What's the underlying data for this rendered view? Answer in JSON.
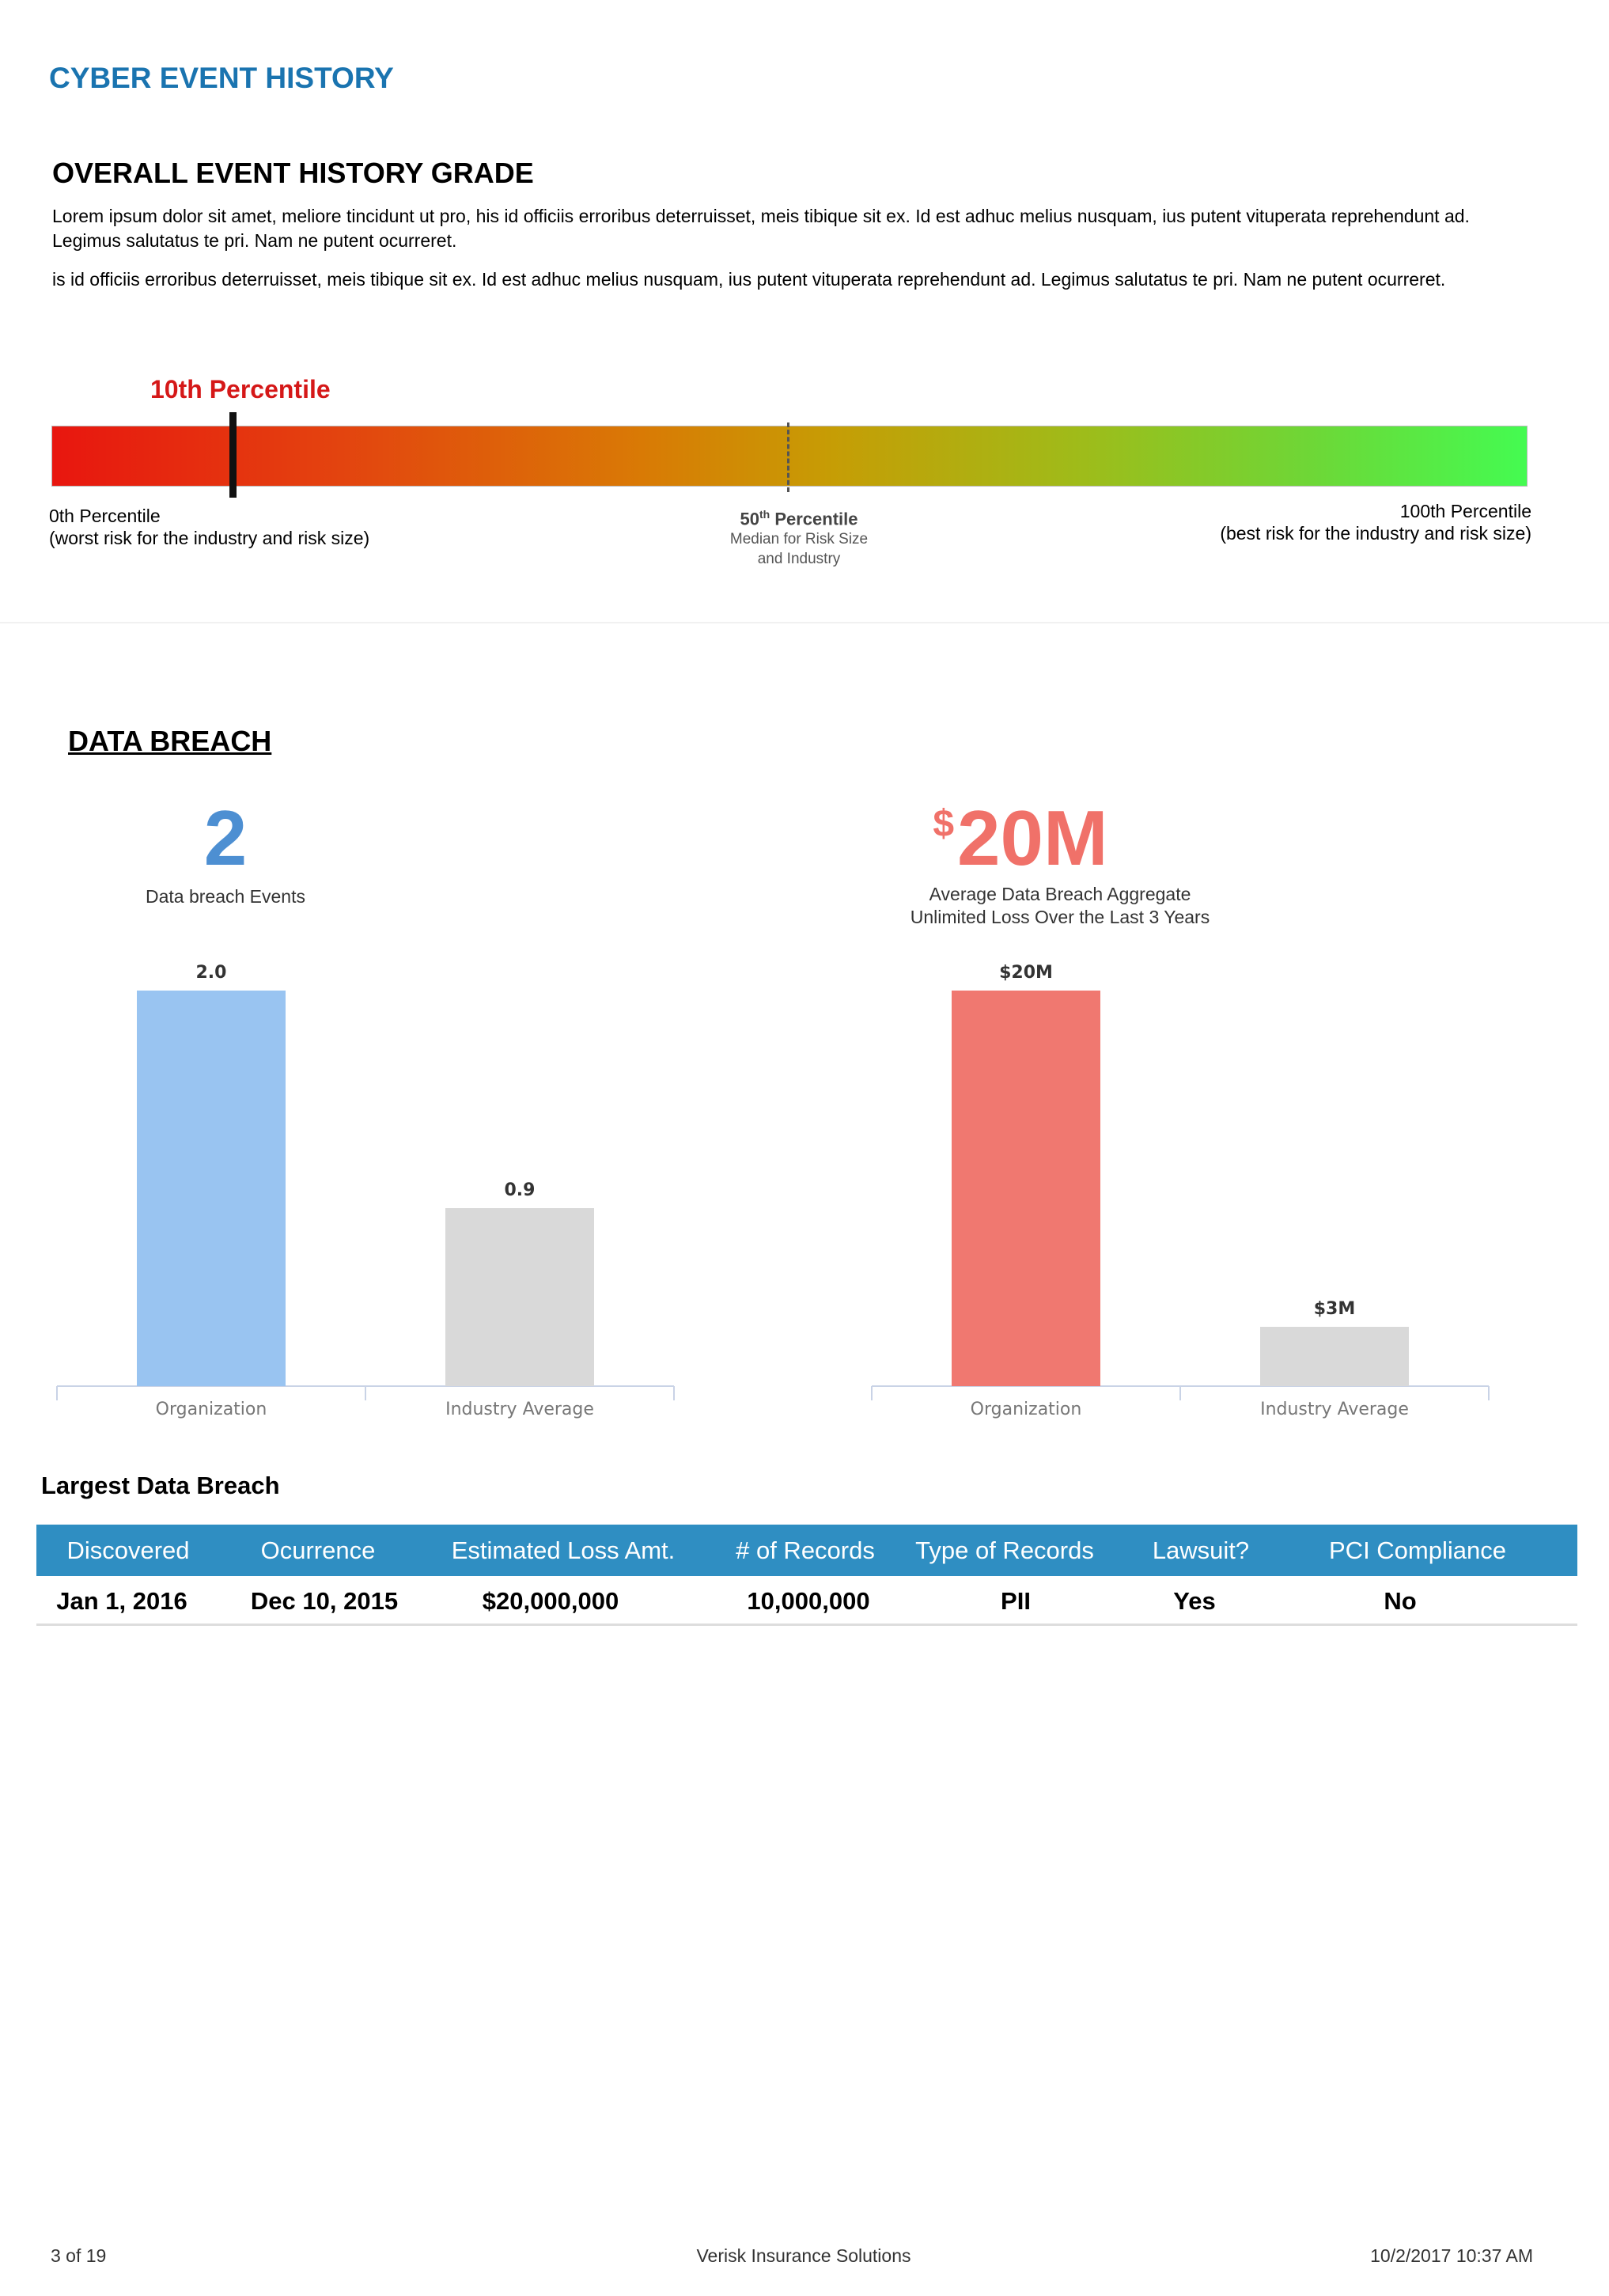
{
  "header": {
    "section_title": "CYBER EVENT HISTORY"
  },
  "grade": {
    "title": "OVERALL EVENT HISTORY GRADE",
    "para1": "Lorem ipsum dolor sit amet, meliore tincidunt ut pro, his id officiis erroribus deterruisset, meis tibique sit ex. Id est adhuc melius nusquam, ius putent vituperata reprehendunt ad. Legimus salutatus te pri. Nam ne putent ocurreret.",
    "para2": "is id officiis erroribus deterruisset, meis tibique sit ex. Id est adhuc melius nusquam, ius putent vituperata reprehendunt ad. Legimus salutatus te pri. Nam ne putent ocurreret.",
    "percentile_label": "10th Percentile",
    "percentile_value": 10,
    "left_tick_1": "0th Percentile",
    "left_tick_2": "(worst risk for the industry and risk size)",
    "mid_num": "50",
    "mid_sup": "th",
    "mid_word": "Percentile",
    "mid_sub_1": "Median for Risk Size",
    "mid_sub_2": "and Industry",
    "right_tick_1": "100th Percentile",
    "right_tick_2": "(best risk for the industry and risk size)"
  },
  "data_breach": {
    "title": "DATA BREACH",
    "events_value": "2",
    "events_caption": "Data breach Events",
    "loss_currency": "$",
    "loss_value": "20M",
    "loss_caption_1": "Average Data Breach Aggregate",
    "loss_caption_2": "Unlimited Loss Over the Last 3 Years"
  },
  "chart_data": [
    {
      "type": "bar",
      "categories": [
        "Organization",
        "Industry Average"
      ],
      "values": [
        2.0,
        0.9
      ],
      "value_labels": [
        "2.0",
        "0.9"
      ],
      "colors": [
        "#99c4f1",
        "#d9d9d9"
      ],
      "ylim": [
        0,
        2.0
      ]
    },
    {
      "type": "bar",
      "categories": [
        "Organization",
        "Industry Average"
      ],
      "values": [
        20,
        3
      ],
      "value_labels": [
        "$20M",
        "$3M"
      ],
      "colors": [
        "#f07870",
        "#d9d9d9"
      ],
      "ylim": [
        0,
        20
      ]
    }
  ],
  "largest_breach": {
    "title": "Largest Data Breach",
    "headers": [
      "Discovered",
      "Ocurrence",
      "Estimated Loss Amt.",
      "# of Records",
      "Type of Records",
      "Lawsuit?",
      "PCI Compliance Issues?"
    ],
    "row": [
      "Jan 1, 2016",
      "Dec 10, 2015",
      "$20,000,000",
      "10,000,000",
      "PII",
      "Yes",
      "No"
    ]
  },
  "footer": {
    "page": "3 of 19",
    "company": "Verisk Insurance Solutions",
    "timestamp": "10/2/2017 10:37 AM"
  }
}
